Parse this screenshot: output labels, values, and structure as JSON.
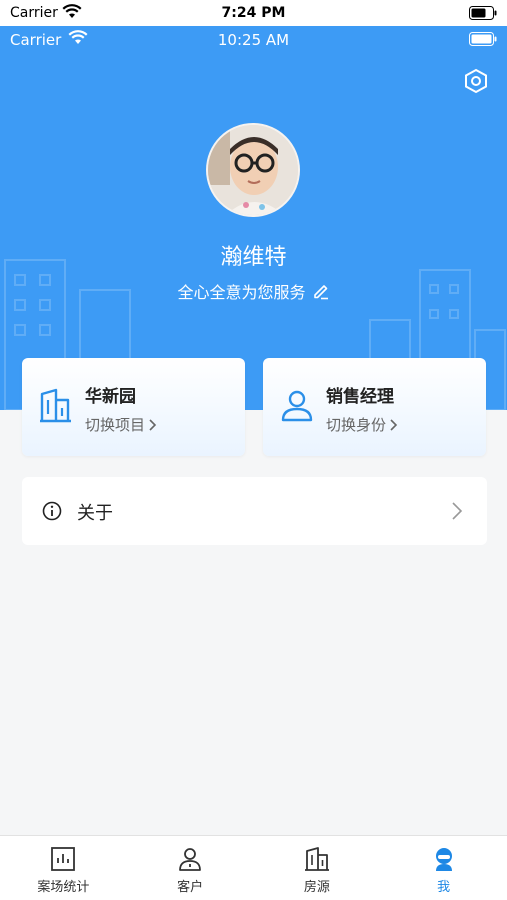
{
  "outer_status": {
    "carrier": "Carrier",
    "time": "7:24 PM"
  },
  "inner_status": {
    "carrier": "Carrier",
    "time": "10:25 AM"
  },
  "profile": {
    "name": "瀚维特",
    "motto": "全心全意为您服务"
  },
  "cards": [
    {
      "title": "华新园",
      "action": "切换项目"
    },
    {
      "title": "销售经理",
      "action": "切换身份"
    }
  ],
  "about": {
    "label": "关于"
  },
  "tabs": [
    {
      "label": "案场统计",
      "icon": "bar-chart-icon"
    },
    {
      "label": "客户",
      "icon": "person-icon"
    },
    {
      "label": "房源",
      "icon": "building-icon"
    },
    {
      "label": "我",
      "icon": "profile-icon"
    }
  ],
  "colors": {
    "accent": "#3d9bf5",
    "tab_active": "#1e88e5"
  }
}
